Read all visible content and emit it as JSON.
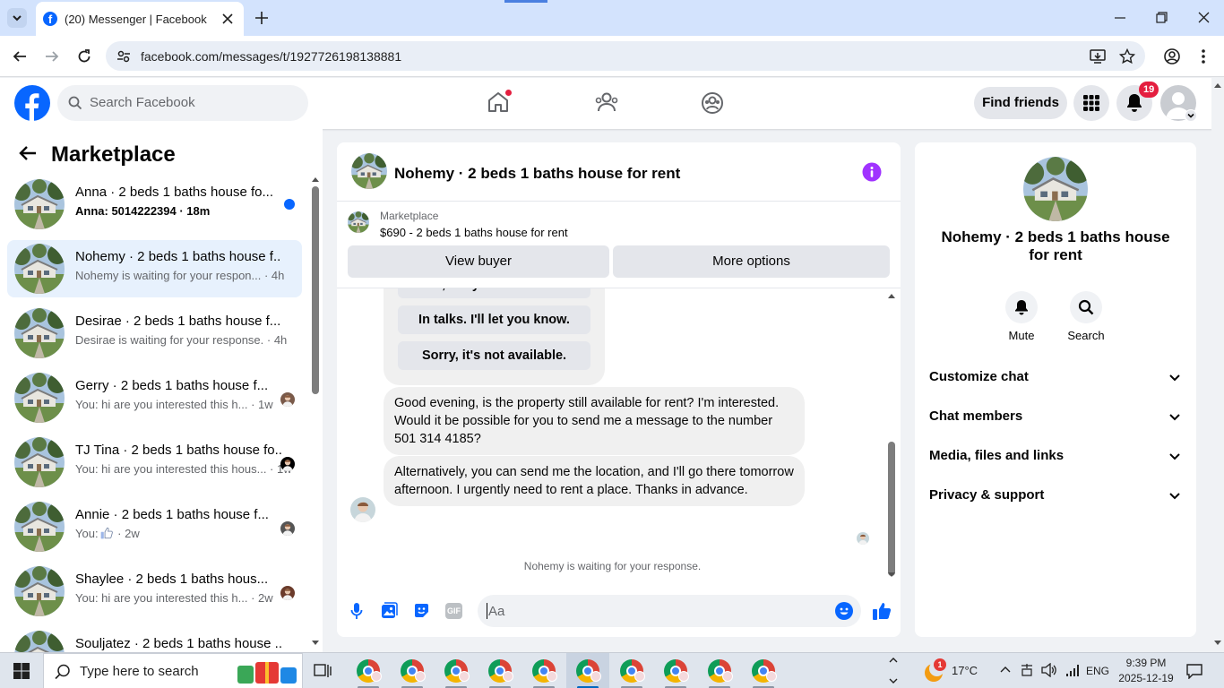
{
  "browser": {
    "tab_title": "(20) Messenger | Facebook",
    "url": "facebook.com/messages/t/1927726198138881"
  },
  "header": {
    "search_placeholder": "Search Facebook",
    "find_friends": "Find friends",
    "notifications_count": "19",
    "brand_color": "#0866ff"
  },
  "sidebar": {
    "title": "Marketplace",
    "conversations": [
      {
        "title": "Anna · 2 beds 1 baths house fo...",
        "subtitle": "Anna: 5014222394 · 18m",
        "unread": true
      },
      {
        "title": "Nohemy · 2 beds 1 baths house f...",
        "subtitle": "Nohemy is waiting for your respon... · 4h",
        "active": true
      },
      {
        "title": "Desirae · 2 beds 1 baths house f...",
        "subtitle": "Desirae is waiting for your response. · 4h"
      },
      {
        "title": "Gerry · 2 beds 1 baths house f...",
        "subtitle": "You: hi are you interested this h... · 1w"
      },
      {
        "title": "TJ Tina · 2 beds 1 baths house fo...",
        "subtitle": "You: hi are you interested this hous... · 1w"
      },
      {
        "title": "Annie · 2 beds 1 baths house f...",
        "subtitle_prefix": "You:",
        "subtitle_suffix": " · 2w"
      },
      {
        "title": "Shaylee · 2 beds 1 baths hous...",
        "subtitle": "You: hi are you interested this h... · 2w"
      },
      {
        "title": "Souljatez · 2 beds 1 baths house ...",
        "subtitle": ""
      }
    ]
  },
  "chat": {
    "title": "Nohemy · 2 beds 1 baths house for rent",
    "marketplace_label": "Marketplace",
    "listing": "$690 - 2 beds 1 baths house for rent",
    "view_buyer": "View buyer",
    "more_options": "More options",
    "quick_replies": [
      "Yes, are you interested?",
      "In talks. I'll let you know.",
      "Sorry, it's not available."
    ],
    "messages": [
      "Good evening, is the property still available for rent? I'm interested. Would it be possible for you to send me a message to the number 501 314 4185?",
      "Alternatively, you can send me the location, and I'll go there tomorrow afternoon. I urgently need to rent a place. Thanks in advance."
    ],
    "waiting_text": "Nohemy is waiting for your response.",
    "composer_placeholder": "Aa",
    "gif_label": "GIF"
  },
  "details": {
    "name": "Nohemy · 2 beds 1 baths house for rent",
    "mute": "Mute",
    "search": "Search",
    "sections": [
      "Customize chat",
      "Chat members",
      "Media, files and links",
      "Privacy & support"
    ]
  },
  "taskbar": {
    "search_placeholder": "Type here to search",
    "weather": "17°C",
    "weather_badge": "1",
    "language": "ENG",
    "time": "9:39 PM",
    "date": "2025-12-19"
  }
}
